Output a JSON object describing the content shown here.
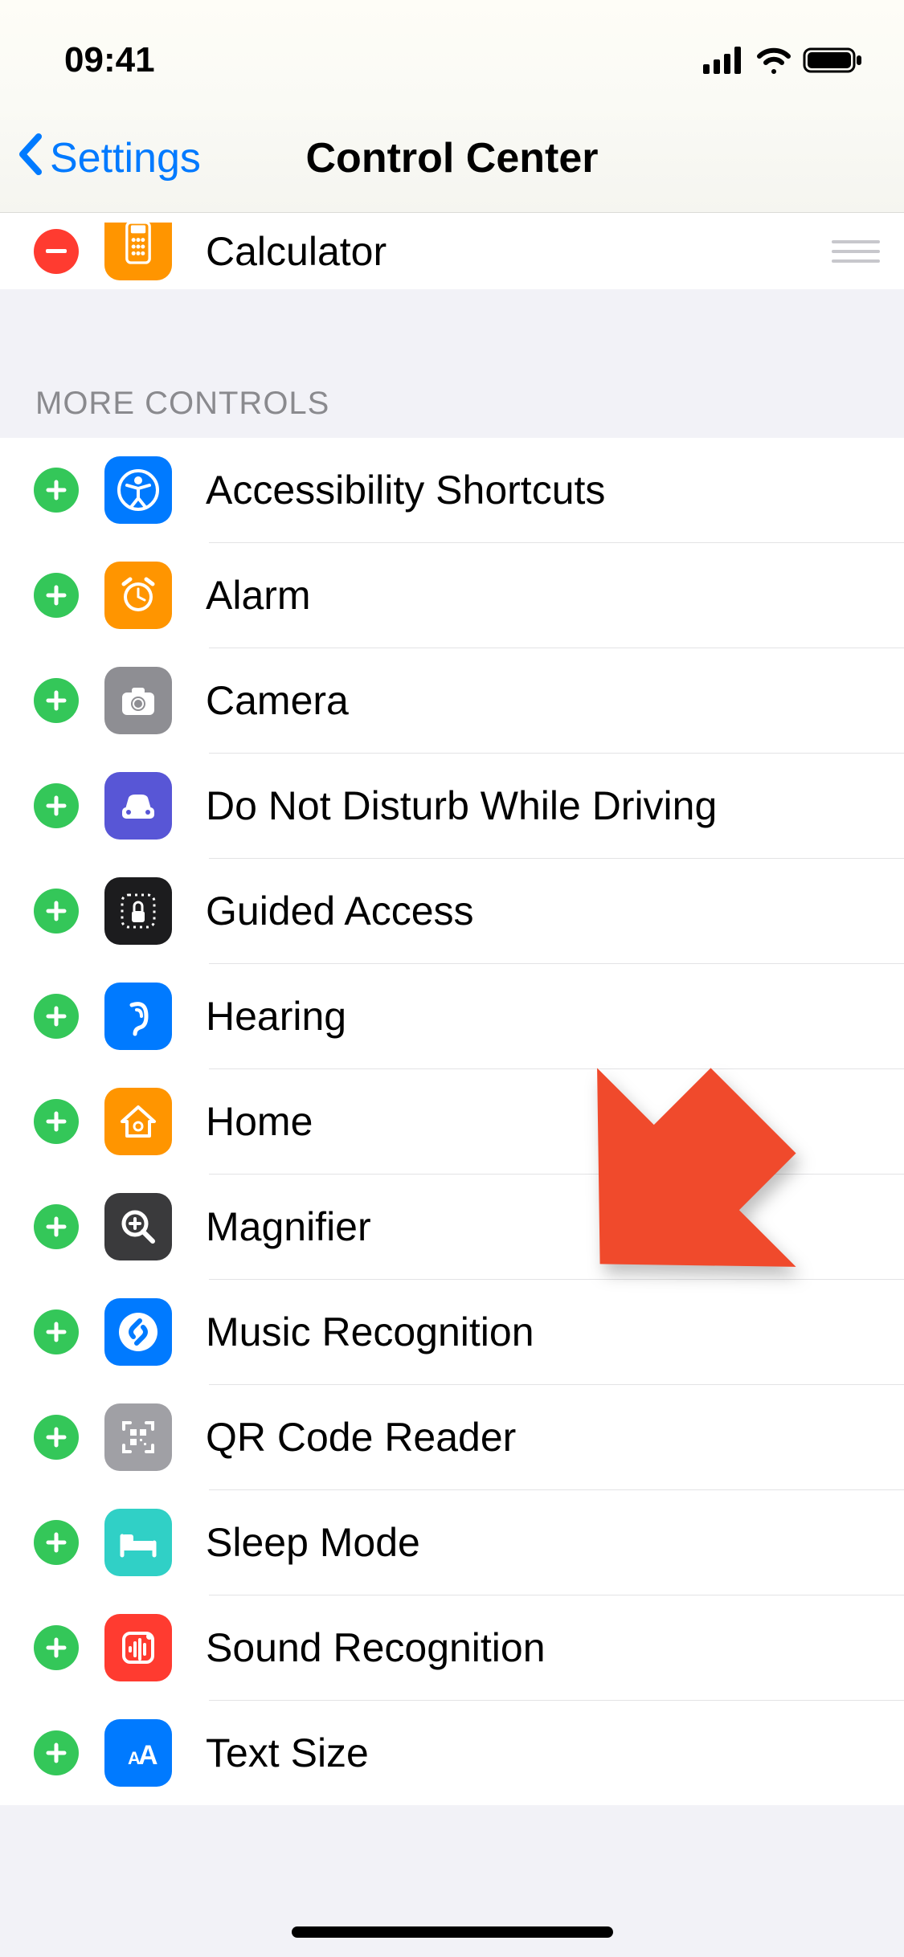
{
  "statusBar": {
    "time": "09:41"
  },
  "nav": {
    "back_label": "Settings",
    "title": "Control Center"
  },
  "included": [
    {
      "label": "Calculator",
      "icon": "calculator-icon"
    }
  ],
  "more_header": "MORE CONTROLS",
  "more": [
    {
      "label": "Accessibility Shortcuts",
      "icon": "accessibility-icon",
      "bg": "bg-blue"
    },
    {
      "label": "Alarm",
      "icon": "alarm-icon",
      "bg": "bg-orange"
    },
    {
      "label": "Camera",
      "icon": "camera-icon",
      "bg": "bg-gray"
    },
    {
      "label": "Do Not Disturb While Driving",
      "icon": "car-icon",
      "bg": "bg-purple"
    },
    {
      "label": "Guided Access",
      "icon": "lock-dotted-icon",
      "bg": "bg-black"
    },
    {
      "label": "Hearing",
      "icon": "ear-icon",
      "bg": "bg-blue"
    },
    {
      "label": "Home",
      "icon": "home-icon",
      "bg": "bg-orange"
    },
    {
      "label": "Magnifier",
      "icon": "magnifier-icon",
      "bg": "bg-darkgray"
    },
    {
      "label": "Music Recognition",
      "icon": "shazam-icon",
      "bg": "bg-blue"
    },
    {
      "label": "QR Code Reader",
      "icon": "qr-icon",
      "bg": "bg-lightgray"
    },
    {
      "label": "Sleep Mode",
      "icon": "bed-icon",
      "bg": "bg-teal"
    },
    {
      "label": "Sound Recognition",
      "icon": "waveform-icon",
      "bg": "bg-red"
    },
    {
      "label": "Text Size",
      "icon": "textsize-icon",
      "bg": "bg-blue"
    }
  ],
  "annotation": {
    "highlight_index": 8,
    "arrow_color": "#f04a2c"
  }
}
